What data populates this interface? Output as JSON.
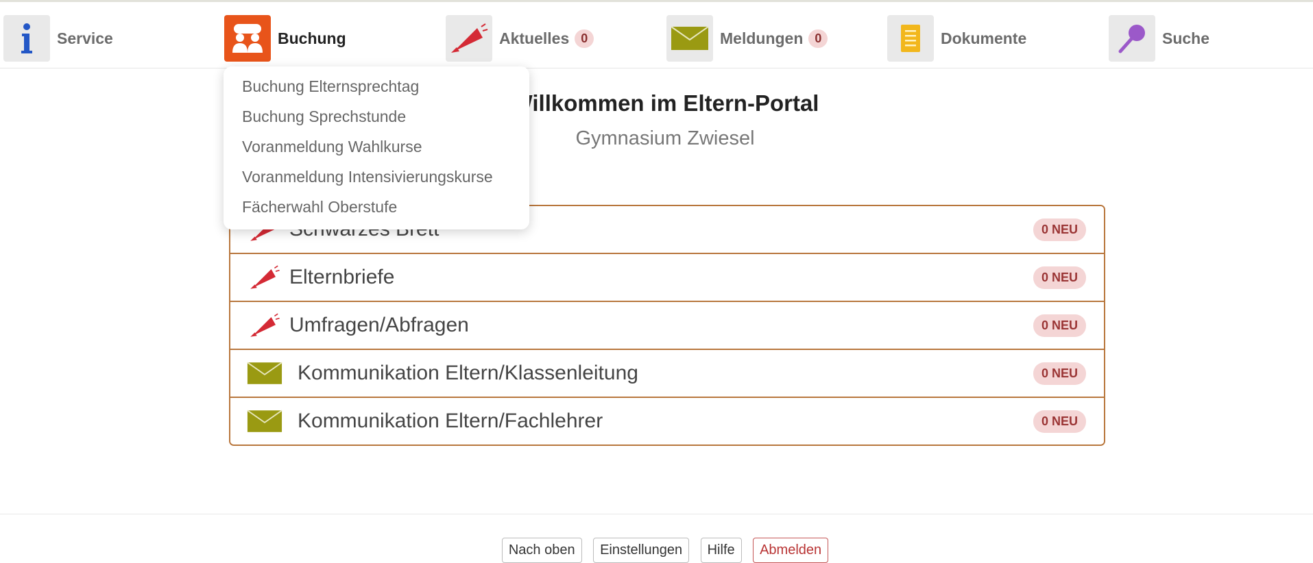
{
  "nav": {
    "service": {
      "label": "Service",
      "icon": "info-icon"
    },
    "buchung": {
      "label": "Buchung",
      "icon": "people-icon"
    },
    "aktuelles": {
      "label": "Aktuelles",
      "count": "0",
      "icon": "megaphone-icon"
    },
    "meldungen": {
      "label": "Meldungen",
      "count": "0",
      "icon": "envelope-icon"
    },
    "dokumente": {
      "label": "Dokumente",
      "icon": "document-icon"
    },
    "suche": {
      "label": "Suche",
      "icon": "magnifier-icon"
    }
  },
  "dropdown": {
    "items": [
      "Buchung Elternsprechtag",
      "Buchung Sprechstunde",
      "Voranmeldung Wahlkurse",
      "Voranmeldung Intensivierungskurse",
      "Fächerwahl Oberstufe"
    ]
  },
  "main": {
    "title": "Willkommen im Eltern-Portal",
    "subtitle": "Gymnasium Zwiesel"
  },
  "list": {
    "items": [
      {
        "label": "Schwarzes Brett",
        "badge": "0 NEU",
        "icon": "megaphone-icon"
      },
      {
        "label": "Elternbriefe",
        "badge": "0 NEU",
        "icon": "megaphone-icon"
      },
      {
        "label": "Umfragen/Abfragen",
        "badge": "0 NEU",
        "icon": "megaphone-icon"
      },
      {
        "label": "Kommunikation Eltern/Klassenleitung",
        "badge": "0 NEU",
        "icon": "envelope-icon"
      },
      {
        "label": "Kommunikation Eltern/Fachlehrer",
        "badge": "0 NEU",
        "icon": "envelope-icon"
      }
    ]
  },
  "footer": {
    "top": "Nach oben",
    "settings": "Einstellungen",
    "help": "Hilfe",
    "logout": "Abmelden"
  },
  "colors": {
    "accent": "#e8541a",
    "border": "#b8763c",
    "badge_bg": "#f4d5d5",
    "badge_text": "#9a3434"
  }
}
